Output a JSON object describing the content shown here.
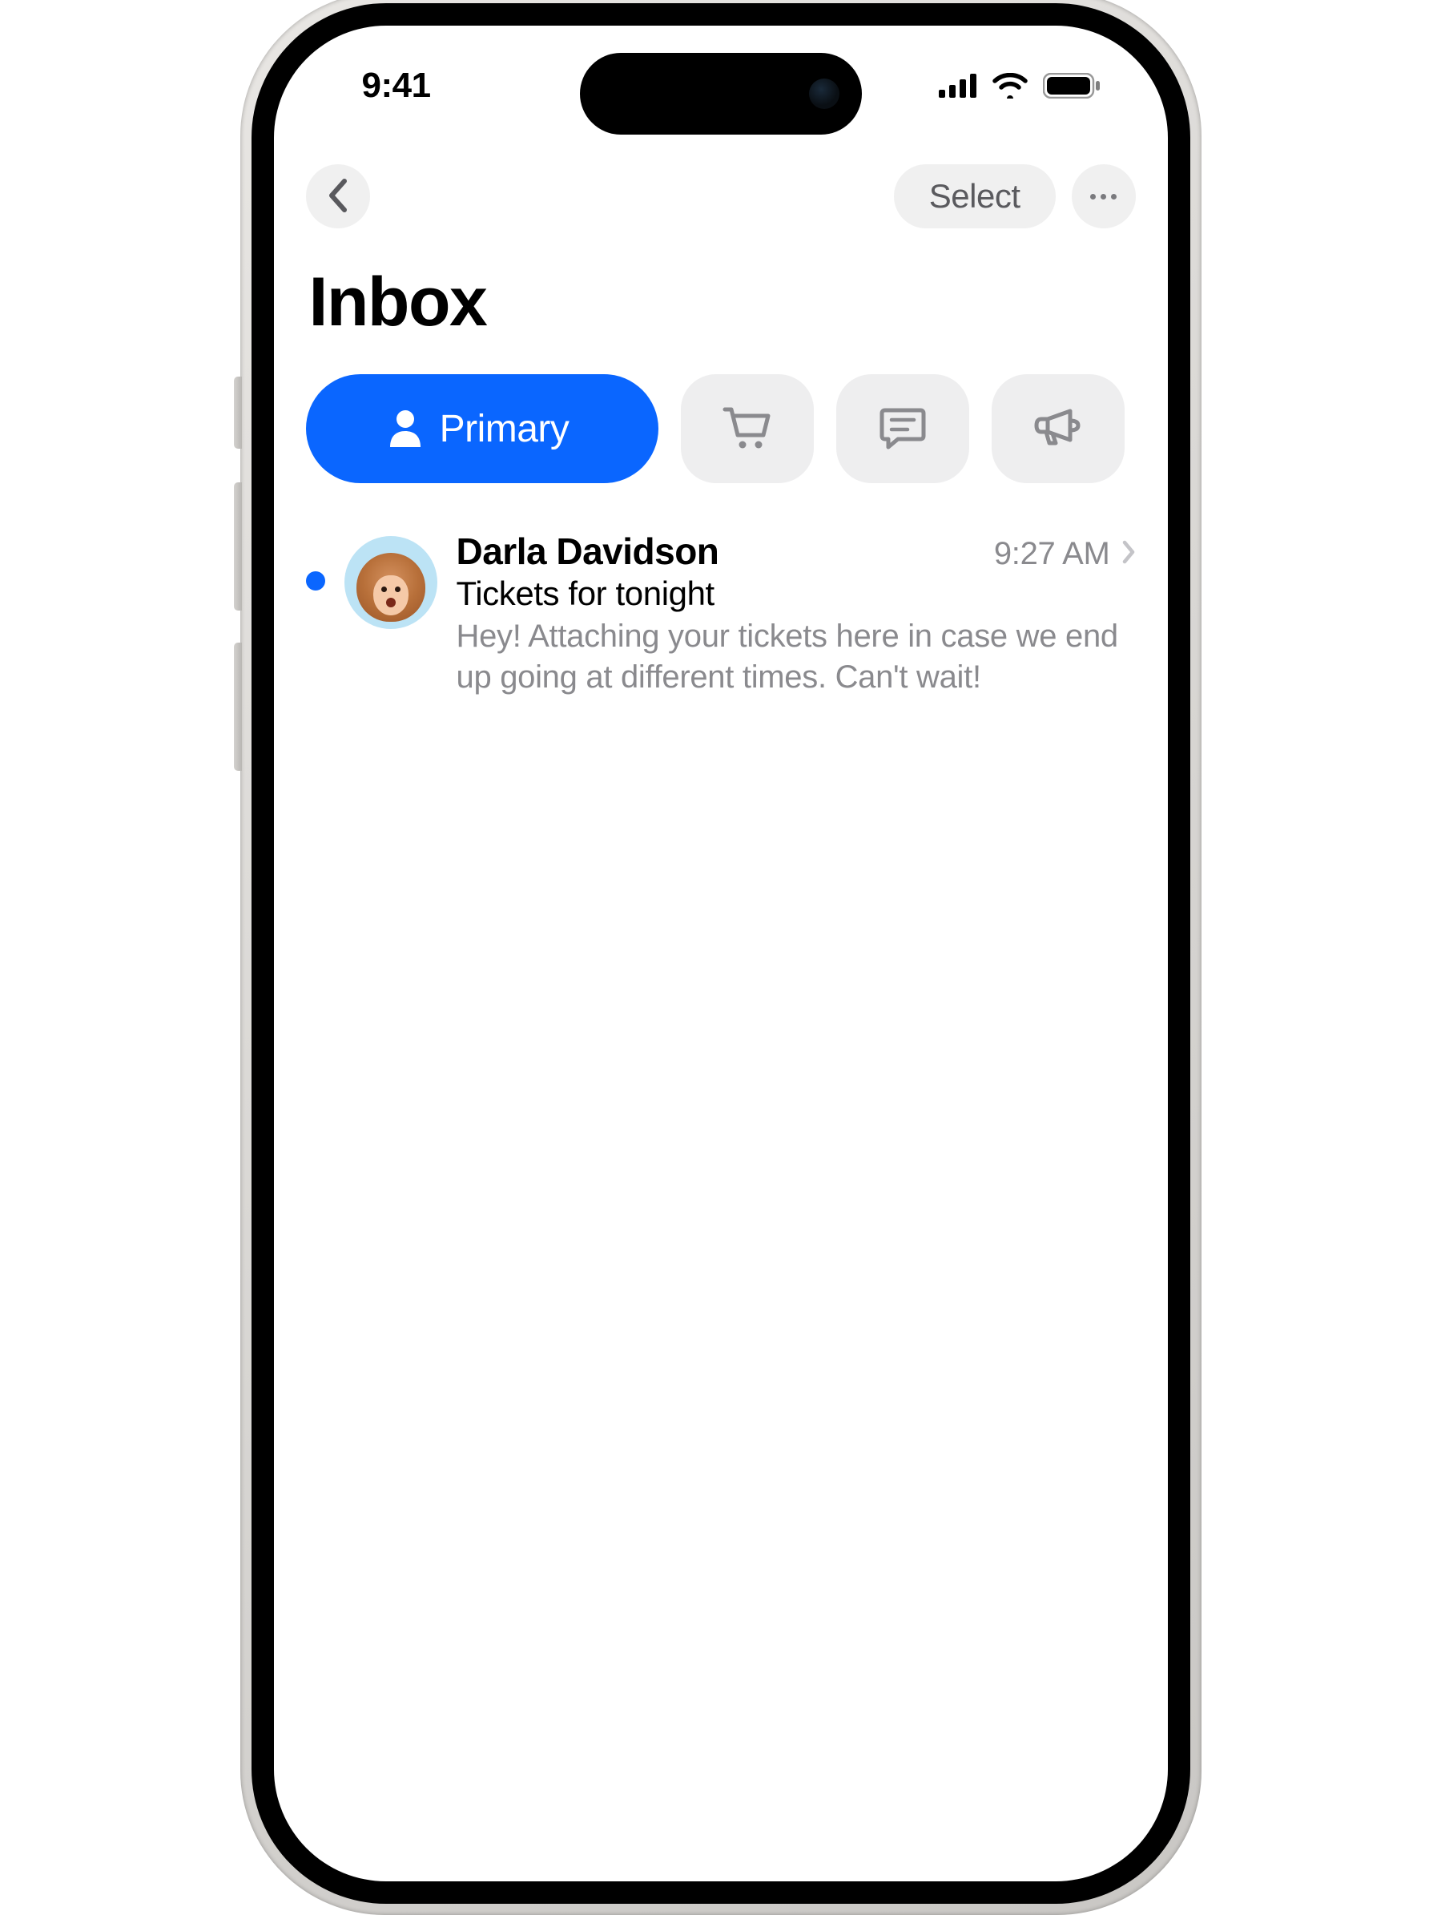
{
  "status_bar": {
    "time": "9:41"
  },
  "nav": {
    "select_label": "Select"
  },
  "page": {
    "title": "Inbox"
  },
  "tabs": {
    "primary_label": "Primary"
  },
  "emails": [
    {
      "sender": "Darla Davidson",
      "time": "9:27 AM",
      "subject": "Tickets for tonight",
      "preview": "Hey! Attaching your tickets here in case we end up going at different times. Can't wait!",
      "unread": true
    }
  ],
  "colors": {
    "accent": "#0a66ff",
    "secondary_bg": "#f0f0f0",
    "tab_bg": "#eeeeef",
    "text_secondary": "#8a8a8e"
  }
}
